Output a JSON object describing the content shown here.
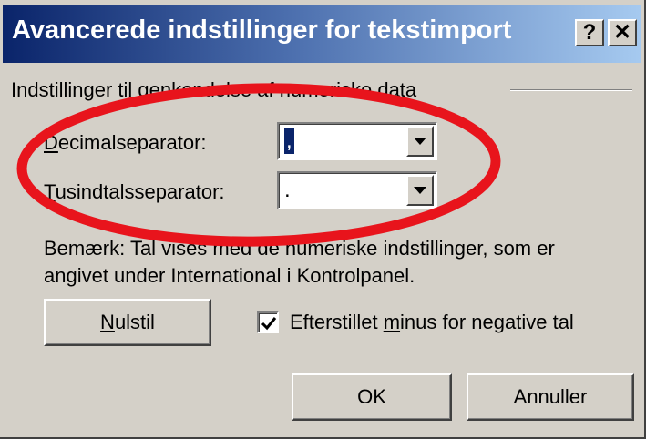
{
  "dialog": {
    "title": "Avancerede indstillinger for tekstimport",
    "help_button": "?",
    "close_button": "✕"
  },
  "group": {
    "label": "Indstillinger til genkendelse af numeriske data"
  },
  "fields": {
    "decimal_separator": {
      "label_underline": "D",
      "label_rest": "ecimalseparator:",
      "value": ","
    },
    "thousands_separator": {
      "label_underline": "T",
      "label_rest": "usindtalsseparator:",
      "value": "."
    }
  },
  "note": {
    "line1": "Bemærk: Tal vises med de numeriske indstillinger, som er",
    "line2": "angivet under International i Kontrolpanel."
  },
  "buttons": {
    "reset_underline": "N",
    "reset_rest": "ulstil",
    "ok": "OK",
    "cancel": "Annuller"
  },
  "trailing_minus": {
    "checked": true,
    "label_before": "Efterstillet ",
    "label_underline": "m",
    "label_after": "inus for negative tal"
  },
  "annotation": {
    "color": "#e8141c"
  }
}
